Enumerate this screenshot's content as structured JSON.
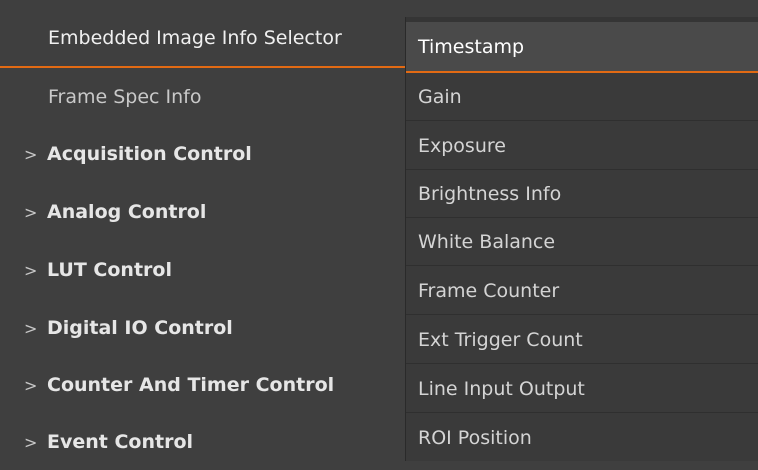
{
  "tree": {
    "selector_label": "Embedded Image Info Selector",
    "frame_spec_label": "Frame Spec Info",
    "groups": [
      "Acquisition Control",
      "Analog Control",
      "LUT Control",
      "Digital IO Control",
      "Counter And Timer Control",
      "Event Control"
    ],
    "expand_glyph": ">"
  },
  "dropdown": {
    "selected": "Timestamp",
    "options": [
      "Timestamp",
      "Gain",
      "Exposure",
      "Brightness Info",
      "White Balance",
      "Frame Counter",
      "Ext Trigger Count",
      "Line Input Output",
      "ROI Position"
    ]
  },
  "colors": {
    "accent": "#e26a13",
    "background": "#3f3f3f"
  }
}
